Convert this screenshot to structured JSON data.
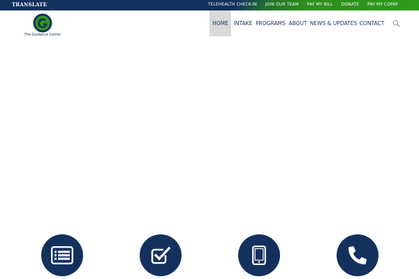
{
  "topbar": {
    "translate_label": "TRANSLATE",
    "links": [
      {
        "label": "TELEHEALTH CHECK-IN"
      },
      {
        "label": "JOIN OUR TEAM"
      },
      {
        "label": "PAY MY BILL"
      },
      {
        "label": "DONATE"
      },
      {
        "label": "PAY MY COPAY"
      }
    ]
  },
  "header": {
    "logo_text": "The Guidance Center",
    "nav": [
      {
        "label": "HOME",
        "active": true
      },
      {
        "label": "INTAKE"
      },
      {
        "label": "PROGRAMS"
      },
      {
        "label": "ABOUT"
      },
      {
        "label": "NEWS & UPDATES"
      },
      {
        "label": "CONTACT"
      }
    ],
    "search_icon": "search-icon"
  },
  "features": [
    {
      "icon": "list-form-icon"
    },
    {
      "icon": "checkbox-icon"
    },
    {
      "icon": "tablet-icon"
    },
    {
      "icon": "phone-icon"
    }
  ],
  "colors": {
    "navy": "#14305d",
    "green": "#2f9a1c",
    "nav_active_bg": "#d9d9d9"
  }
}
